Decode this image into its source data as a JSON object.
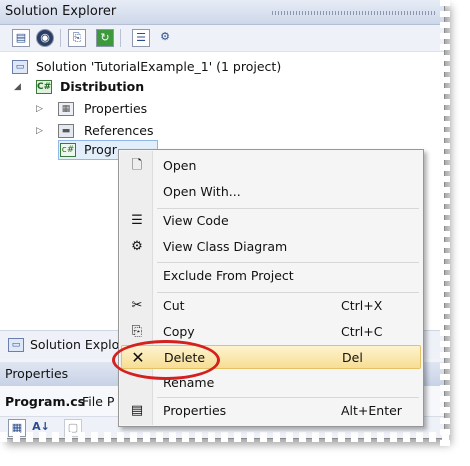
{
  "solution_explorer": {
    "title": "Solution Explorer",
    "toolbar_icons": [
      "properties-icon",
      "show-all-files-icon",
      "refresh-icon",
      "view-code-icon",
      "view-class-diagram-icon"
    ],
    "tree": {
      "solution": "Solution 'TutorialExample_1' (1 project)",
      "project": "Distribution",
      "items": [
        "Properties",
        "References",
        "Progr"
      ]
    },
    "bottom_tab": "Solution Explor"
  },
  "properties_panel": {
    "title": "Properties",
    "object_name": "Program.cs",
    "object_type": "File P"
  },
  "context_menu": {
    "items": [
      {
        "label": "Open",
        "shortcut": "",
        "icon": "open-file-icon"
      },
      {
        "label": "Open With...",
        "shortcut": "",
        "icon": ""
      },
      {
        "label": "View Code",
        "shortcut": "",
        "icon": "view-code-icon"
      },
      {
        "label": "View Class Diagram",
        "shortcut": "",
        "icon": "class-diagram-icon"
      },
      {
        "label": "Exclude From Project",
        "shortcut": "",
        "icon": ""
      },
      {
        "label": "Cut",
        "shortcut": "Ctrl+X",
        "icon": "scissors-icon"
      },
      {
        "label": "Copy",
        "shortcut": "Ctrl+C",
        "icon": "copy-icon"
      },
      {
        "label": "Delete",
        "shortcut": "Del",
        "icon": "delete-x-icon"
      },
      {
        "label": "Rename",
        "shortcut": "",
        "icon": ""
      },
      {
        "label": "Properties",
        "shortcut": "Alt+Enter",
        "icon": "properties-icon"
      }
    ]
  },
  "colors": {
    "highlight": "#f7de94",
    "annotation_ring": "#d52020",
    "selection": "#e3eefb"
  }
}
